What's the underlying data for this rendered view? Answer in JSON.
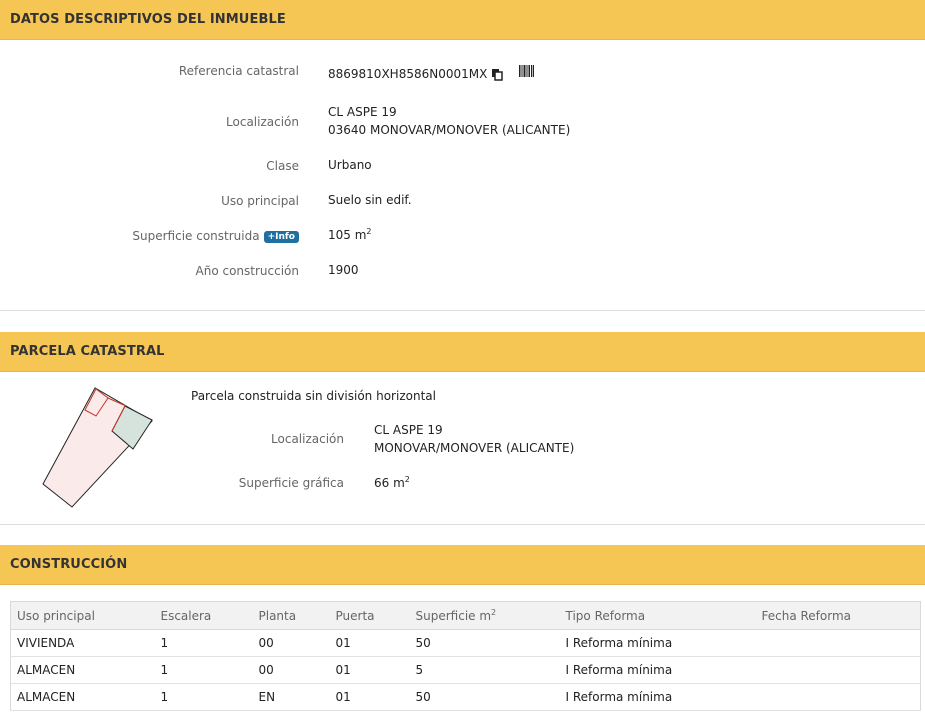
{
  "datos": {
    "title": "DATOS DESCRIPTIVOS DEL INMUEBLE",
    "rows": [
      {
        "label": "Referencia catastral",
        "value": "8869810XH8586N0001MX"
      },
      {
        "label": "Localización",
        "value1": "CL ASPE 19",
        "value2": "03640 MONOVAR/MONOVER (ALICANTE)"
      },
      {
        "label": "Clase",
        "value": "Urbano"
      },
      {
        "label": "Uso principal",
        "value": "Suelo sin edif."
      },
      {
        "label": "Superficie construida",
        "badge": "+Info",
        "value": "105 m",
        "unit_sup": "2"
      },
      {
        "label": "Año construcción",
        "value": "1900"
      }
    ]
  },
  "parcela": {
    "title": "PARCELA CATASTRAL",
    "heading": "Parcela construida sin división horizontal",
    "localizacion_label": "Localización",
    "localizacion_line1": "CL ASPE 19",
    "localizacion_line2": "MONOVAR/MONOVER (ALICANTE)",
    "superficie_label": "Superficie gráfica",
    "superficie_value": "66 m",
    "superficie_sup": "2"
  },
  "construccion": {
    "title": "CONSTRUCCIÓN",
    "headers": [
      "Uso principal",
      "Escalera",
      "Planta",
      "Puerta",
      "Superficie m",
      "Tipo Reforma",
      "Fecha Reforma"
    ],
    "superficie_header_sup": "2",
    "rows": [
      [
        "VIVIENDA",
        "1",
        "00",
        "01",
        "50",
        "I Reforma mínima",
        ""
      ],
      [
        "ALMACEN",
        "1",
        "00",
        "01",
        "5",
        "I Reforma mínima",
        ""
      ],
      [
        "ALMACEN",
        "1",
        "EN",
        "01",
        "50",
        "I Reforma mínima",
        ""
      ]
    ]
  },
  "colors": {
    "header_bg": "#f6c655",
    "badge_bg": "#1f6fa0"
  },
  "icons": {
    "copy": "copy-icon",
    "barcode": "barcode-icon"
  }
}
